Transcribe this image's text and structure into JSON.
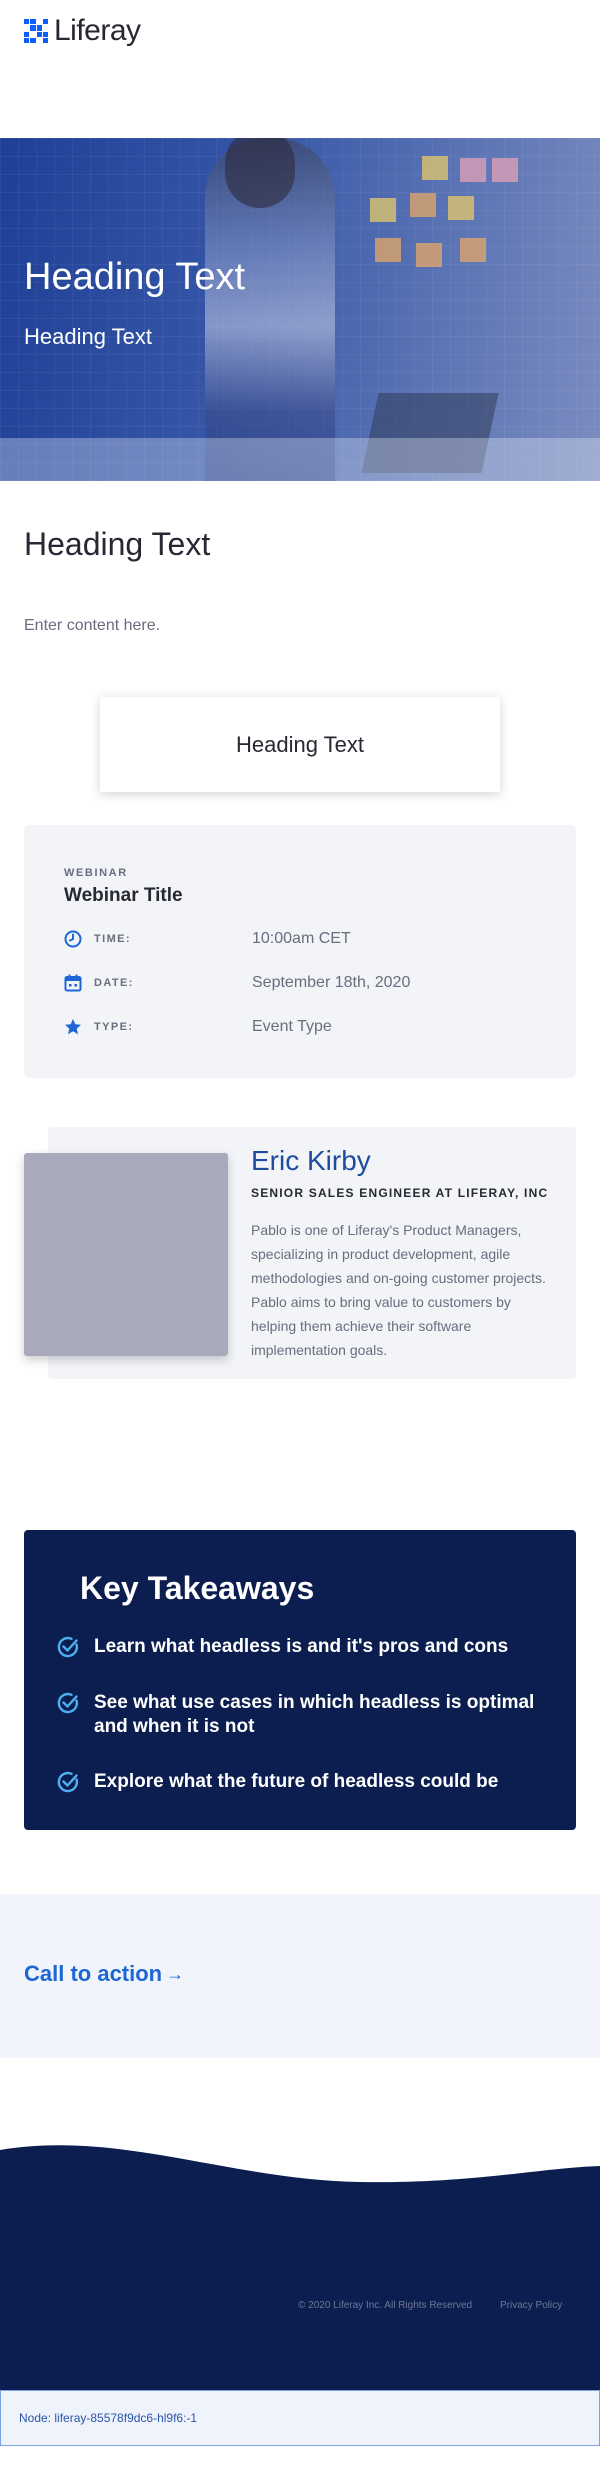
{
  "header": {
    "logo_text": "Liferay"
  },
  "hero": {
    "title": "Heading Text",
    "subtitle": "Heading Text"
  },
  "intro": {
    "heading": "Heading Text",
    "content": "Enter content here."
  },
  "card": {
    "title": "Heading Text"
  },
  "webinar": {
    "kicker": "WEBINAR",
    "title": "Webinar Title",
    "rows": [
      {
        "icon": "clock-icon",
        "label": "TIME:",
        "value": "10:00am CET"
      },
      {
        "icon": "calendar-icon",
        "label": "DATE:",
        "value": "September 18th, 2020"
      },
      {
        "icon": "star-icon",
        "label": "TYPE:",
        "value": "Event Type"
      }
    ]
  },
  "speaker": {
    "name": "Eric Kirby",
    "role": "SENIOR SALES ENGINEER AT LIFERAY, INC",
    "bio": "Pablo is one of Liferay's Product Managers, specializing in product development, agile methodologies and on-going customer projects. Pablo aims to bring value to customers by helping them achieve their software implementation goals."
  },
  "takeaways": {
    "title": "Key Takeaways",
    "items": [
      "Learn what headless is and it's pros and cons",
      "See what use cases in which headless is optimal and when it is not",
      "Explore what the future of headless could be"
    ]
  },
  "cta": {
    "label": "Call to action",
    "arrow": "→"
  },
  "footer": {
    "copyright": "© 2020 Liferay Inc. All Rights Reserved",
    "privacy": "Privacy Policy"
  },
  "node_bar": {
    "text": "Node: liferay-85578f9dc6-hl9f6:-1"
  },
  "colors": {
    "brand_blue": "#0b5fff",
    "navy": "#0b1e4f",
    "accent_check": "#4fb0f0",
    "cta_blue": "#1c66d6"
  }
}
